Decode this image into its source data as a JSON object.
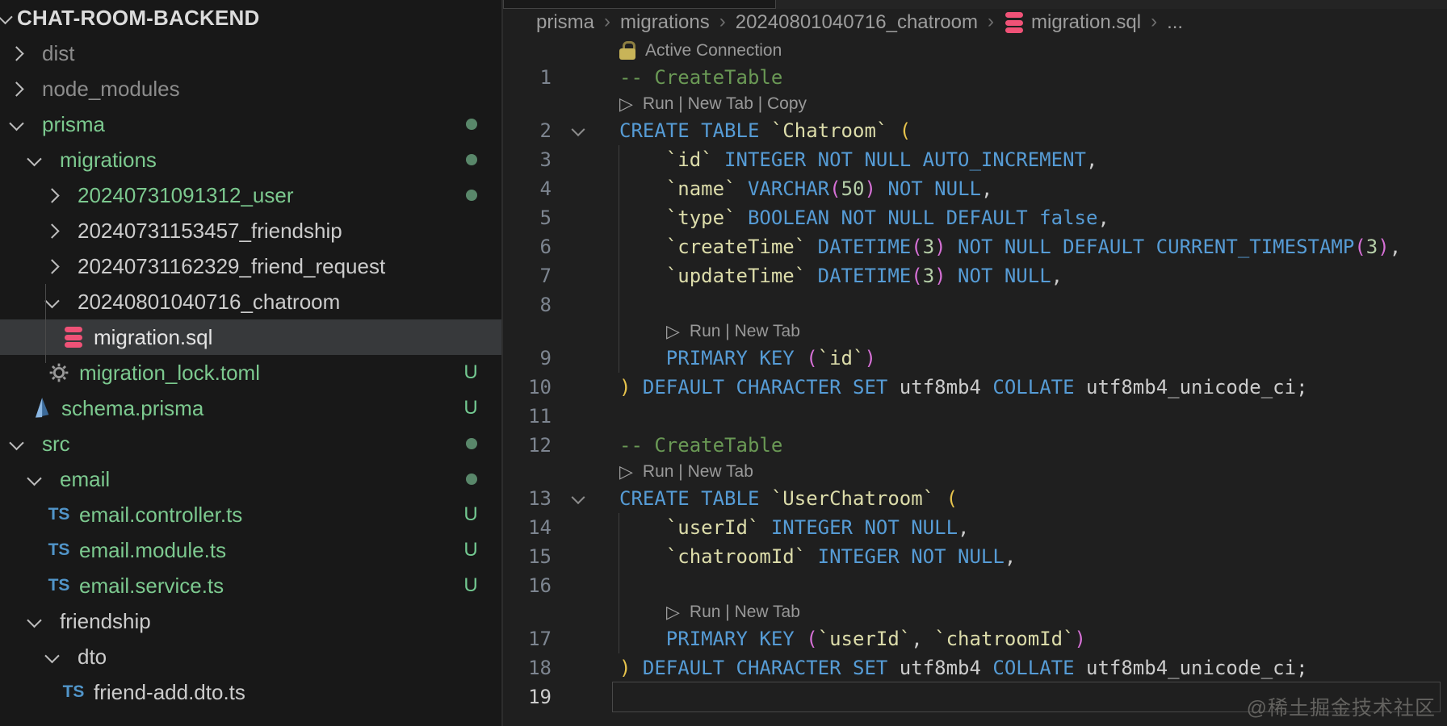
{
  "sidebar": {
    "title": "CHAT-ROOM-BACKEND",
    "items": [
      {
        "label": "dist",
        "depth": 1,
        "kind": "folder",
        "chev": "right",
        "color": "dim"
      },
      {
        "label": "node_modules",
        "depth": 1,
        "kind": "folder",
        "chev": "right",
        "color": "dim"
      },
      {
        "label": "prisma",
        "depth": 1,
        "kind": "folder",
        "chev": "down",
        "color": "green",
        "badge": "dot"
      },
      {
        "label": "migrations",
        "depth": 2,
        "kind": "folder",
        "chev": "down",
        "color": "green",
        "badge": "dot"
      },
      {
        "label": "20240731091312_user",
        "depth": 3,
        "kind": "folder",
        "chev": "right",
        "color": "green",
        "badge": "dot"
      },
      {
        "label": "20240731153457_friendship",
        "depth": 3,
        "kind": "folder",
        "chev": "right",
        "color": "normal"
      },
      {
        "label": "20240731162329_friend_request",
        "depth": 3,
        "kind": "folder",
        "chev": "right",
        "color": "normal"
      },
      {
        "label": "20240801040716_chatroom",
        "depth": 3,
        "kind": "folder",
        "chev": "down",
        "color": "normal"
      },
      {
        "label": "migration.sql",
        "depth": 4,
        "kind": "file",
        "icon": "database",
        "color": "normal",
        "selected": true
      },
      {
        "label": "migration_lock.toml",
        "depth": 3,
        "kind": "file",
        "icon": "gear",
        "color": "green",
        "badge": "U"
      },
      {
        "label": "schema.prisma",
        "depth": 2,
        "kind": "file",
        "icon": "prisma",
        "color": "green",
        "badge": "U"
      },
      {
        "label": "src",
        "depth": 1,
        "kind": "folder",
        "chev": "down",
        "color": "green",
        "badge": "dot"
      },
      {
        "label": "email",
        "depth": 2,
        "kind": "folder",
        "chev": "down",
        "color": "green",
        "badge": "dot"
      },
      {
        "label": "email.controller.ts",
        "depth": 3,
        "kind": "file",
        "icon": "ts",
        "color": "green",
        "badge": "U"
      },
      {
        "label": "email.module.ts",
        "depth": 3,
        "kind": "file",
        "icon": "ts",
        "color": "green",
        "badge": "U"
      },
      {
        "label": "email.service.ts",
        "depth": 3,
        "kind": "file",
        "icon": "ts",
        "color": "green",
        "badge": "U"
      },
      {
        "label": "friendship",
        "depth": 2,
        "kind": "folder",
        "chev": "down",
        "color": "normal"
      },
      {
        "label": "dto",
        "depth": 3,
        "kind": "folder",
        "chev": "down",
        "color": "normal"
      },
      {
        "label": "friend-add.dto.ts",
        "depth": 4,
        "kind": "file",
        "icon": "ts",
        "color": "normal"
      }
    ]
  },
  "editor": {
    "breadcrumbs": [
      {
        "label": "prisma"
      },
      {
        "label": "migrations"
      },
      {
        "label": "20240801040716_chatroom"
      },
      {
        "label": "migration.sql",
        "icon": "database"
      },
      {
        "label": "..."
      }
    ],
    "rows": [
      {
        "type": "lens",
        "icon": "lock",
        "text": "Active Connection",
        "indent": 0
      },
      {
        "type": "code",
        "num": 1,
        "tokens": [
          [
            "cm",
            "-- CreateTable"
          ]
        ]
      },
      {
        "type": "lens",
        "icon": "play",
        "text": "Run | New Tab | Copy",
        "indent": 0
      },
      {
        "type": "code",
        "num": 2,
        "fold": true,
        "tokens": [
          [
            "kw",
            "CREATE TABLE"
          ],
          [
            "tx",
            " "
          ],
          [
            "id",
            "`Chatroom`"
          ],
          [
            "tx",
            " "
          ],
          [
            "p1",
            "("
          ]
        ]
      },
      {
        "type": "code",
        "num": 3,
        "g": true,
        "tokens": [
          [
            "ws",
            "    "
          ],
          [
            "id",
            "`id`"
          ],
          [
            "tx",
            " "
          ],
          [
            "kw",
            "INTEGER NOT NULL AUTO_INCREMENT"
          ],
          [
            "tx",
            ","
          ]
        ]
      },
      {
        "type": "code",
        "num": 4,
        "g": true,
        "tokens": [
          [
            "ws",
            "    "
          ],
          [
            "id",
            "`name`"
          ],
          [
            "tx",
            " "
          ],
          [
            "kw",
            "VARCHAR"
          ],
          [
            "p2",
            "("
          ],
          [
            "nm",
            "50"
          ],
          [
            "p2",
            ")"
          ],
          [
            "tx",
            " "
          ],
          [
            "kw",
            "NOT NULL"
          ],
          [
            "tx",
            ","
          ]
        ]
      },
      {
        "type": "code",
        "num": 5,
        "g": true,
        "tokens": [
          [
            "ws",
            "    "
          ],
          [
            "id",
            "`type`"
          ],
          [
            "tx",
            " "
          ],
          [
            "kw",
            "BOOLEAN NOT NULL DEFAULT false"
          ],
          [
            "tx",
            ","
          ]
        ]
      },
      {
        "type": "code",
        "num": 6,
        "g": true,
        "tokens": [
          [
            "ws",
            "    "
          ],
          [
            "id",
            "`createTime`"
          ],
          [
            "tx",
            " "
          ],
          [
            "kw",
            "DATETIME"
          ],
          [
            "p2",
            "("
          ],
          [
            "nm",
            "3"
          ],
          [
            "p2",
            ")"
          ],
          [
            "tx",
            " "
          ],
          [
            "kw",
            "NOT NULL DEFAULT CURRENT_TIMESTAMP"
          ],
          [
            "p2",
            "("
          ],
          [
            "nm",
            "3"
          ],
          [
            "p2",
            ")"
          ],
          [
            "tx",
            ","
          ]
        ]
      },
      {
        "type": "code",
        "num": 7,
        "g": true,
        "tokens": [
          [
            "ws",
            "    "
          ],
          [
            "id",
            "`updateTime`"
          ],
          [
            "tx",
            " "
          ],
          [
            "kw",
            "DATETIME"
          ],
          [
            "p2",
            "("
          ],
          [
            "nm",
            "3"
          ],
          [
            "p2",
            ")"
          ],
          [
            "tx",
            " "
          ],
          [
            "kw",
            "NOT NULL"
          ],
          [
            "tx",
            ","
          ]
        ]
      },
      {
        "type": "code",
        "num": 8,
        "g": true,
        "tokens": []
      },
      {
        "type": "lens",
        "icon": "play",
        "text": "Run | New Tab",
        "indent": 1,
        "g": true
      },
      {
        "type": "code",
        "num": 9,
        "g": true,
        "tokens": [
          [
            "ws",
            "    "
          ],
          [
            "kw",
            "PRIMARY KEY"
          ],
          [
            "tx",
            " "
          ],
          [
            "p2",
            "("
          ],
          [
            "id",
            "`id`"
          ],
          [
            "p2",
            ")"
          ]
        ]
      },
      {
        "type": "code",
        "num": 10,
        "tokens": [
          [
            "p1",
            ")"
          ],
          [
            "tx",
            " "
          ],
          [
            "kw",
            "DEFAULT CHARACTER SET"
          ],
          [
            "tx",
            " utf8mb4 "
          ],
          [
            "kw",
            "COLLATE"
          ],
          [
            "tx",
            " utf8mb4_unicode_ci;"
          ]
        ]
      },
      {
        "type": "code",
        "num": 11,
        "tokens": []
      },
      {
        "type": "code",
        "num": 12,
        "tokens": [
          [
            "cm",
            "-- CreateTable"
          ]
        ]
      },
      {
        "type": "lens",
        "icon": "play",
        "text": "Run | New Tab",
        "indent": 0
      },
      {
        "type": "code",
        "num": 13,
        "fold": true,
        "tokens": [
          [
            "kw",
            "CREATE TABLE"
          ],
          [
            "tx",
            " "
          ],
          [
            "id",
            "`UserChatroom`"
          ],
          [
            "tx",
            " "
          ],
          [
            "p1",
            "("
          ]
        ]
      },
      {
        "type": "code",
        "num": 14,
        "g": true,
        "tokens": [
          [
            "ws",
            "    "
          ],
          [
            "id",
            "`userId`"
          ],
          [
            "tx",
            " "
          ],
          [
            "kw",
            "INTEGER NOT NULL"
          ],
          [
            "tx",
            ","
          ]
        ]
      },
      {
        "type": "code",
        "num": 15,
        "g": true,
        "tokens": [
          [
            "ws",
            "    "
          ],
          [
            "id",
            "`chatroomId`"
          ],
          [
            "tx",
            " "
          ],
          [
            "kw",
            "INTEGER NOT NULL"
          ],
          [
            "tx",
            ","
          ]
        ]
      },
      {
        "type": "code",
        "num": 16,
        "g": true,
        "tokens": []
      },
      {
        "type": "lens",
        "icon": "play",
        "text": "Run | New Tab",
        "indent": 1,
        "g": true
      },
      {
        "type": "code",
        "num": 17,
        "g": true,
        "tokens": [
          [
            "ws",
            "    "
          ],
          [
            "kw",
            "PRIMARY KEY"
          ],
          [
            "tx",
            " "
          ],
          [
            "p2",
            "("
          ],
          [
            "id",
            "`userId`"
          ],
          [
            "tx",
            ", "
          ],
          [
            "id",
            "`chatroomId`"
          ],
          [
            "p2",
            ")"
          ]
        ]
      },
      {
        "type": "code",
        "num": 18,
        "tokens": [
          [
            "p1",
            ")"
          ],
          [
            "tx",
            " "
          ],
          [
            "kw",
            "DEFAULT CHARACTER SET"
          ],
          [
            "tx",
            " utf8mb4 "
          ],
          [
            "kw",
            "COLLATE"
          ],
          [
            "tx",
            " utf8mb4_unicode_ci;"
          ]
        ]
      },
      {
        "type": "code",
        "num": 19,
        "cur": true,
        "tokens": []
      }
    ],
    "watermark": "@稀土掘金技术社区"
  },
  "colors": {
    "sidebar_bg": "#181818",
    "editor_bg": "#1f1f1f",
    "selection_bg": "#37393b",
    "untracked_green": "#73c991",
    "keyword_blue": "#569cd6",
    "ident_yellow": "#dcdcaa",
    "comment_green": "#6a9955",
    "number_green": "#b5cea8",
    "bracket_gold": "#e6c34c",
    "bracket_pink": "#d670d6",
    "db_icon_pink": "#ef5277"
  }
}
